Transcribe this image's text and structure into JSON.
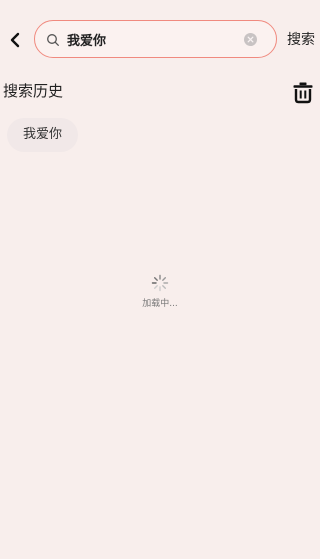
{
  "search": {
    "query": "我爱你",
    "action_label": "搜索"
  },
  "history": {
    "title": "搜索历史",
    "items": [
      {
        "label": "我爱你"
      }
    ]
  },
  "loading": {
    "text": "加载中..."
  },
  "icons": {
    "back": "chevron-left-icon",
    "search": "search-icon",
    "clear": "clear-circle-icon",
    "trash": "trash-icon",
    "spinner": "spinner-icon"
  },
  "colors": {
    "background": "#f8eeec",
    "search_border": "#f08a7f",
    "chip_background": "#f1e8e8"
  }
}
